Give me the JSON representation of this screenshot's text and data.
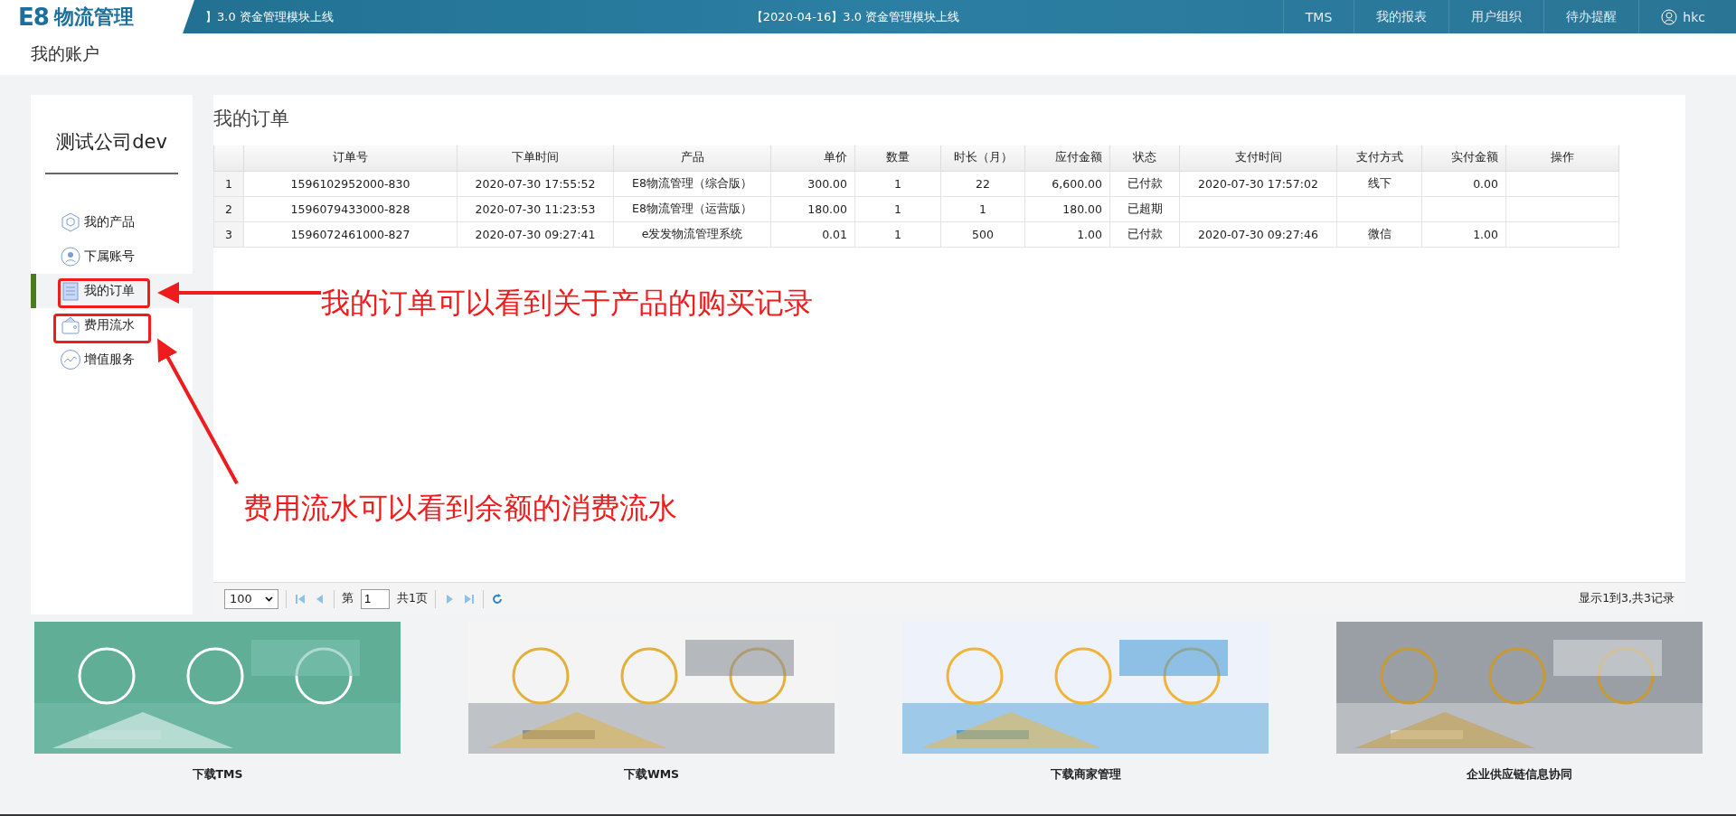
{
  "topbar": {
    "logo_mark": "E8",
    "logo_text": "物流管理",
    "tickers": [
      "】3.0 资金管理模块上线",
      "【2020-04-16】3.0 资金管理模块上线"
    ],
    "nav": [
      "TMS",
      "我的报表",
      "用户组织",
      "待办提醒"
    ],
    "user": "hkc"
  },
  "page_title": "我的账户",
  "sidebar": {
    "company": "测试公司dev",
    "items": [
      {
        "label": "我的产品",
        "selected": false
      },
      {
        "label": "下属账号",
        "selected": false
      },
      {
        "label": "我的订单",
        "selected": true
      },
      {
        "label": "费用流水",
        "selected": false
      },
      {
        "label": "增值服务",
        "selected": false
      }
    ]
  },
  "section_title": "我的订单",
  "table": {
    "columns": [
      "订单号",
      "下单时间",
      "产品",
      "单价",
      "数量",
      "时长（月）",
      "应付金额",
      "状态",
      "支付时间",
      "支付方式",
      "实付金额",
      "操作"
    ],
    "rows": [
      {
        "index": "1",
        "cells": [
          "1596102952000-830",
          "2020-07-30 17:55:52",
          "E8物流管理（综合版）",
          "300.00",
          "1",
          "22",
          "6,600.00",
          "已付款",
          "2020-07-30 17:57:02",
          "线下",
          "0.00",
          ""
        ]
      },
      {
        "index": "2",
        "cells": [
          "1596079433000-828",
          "2020-07-30 11:23:53",
          "E8物流管理（运营版）",
          "180.00",
          "1",
          "1",
          "180.00",
          "已超期",
          "",
          "",
          "",
          ""
        ]
      },
      {
        "index": "3",
        "cells": [
          "1596072461000-827",
          "2020-07-30 09:27:41",
          "e发发物流管理系统",
          "0.01",
          "1",
          "500",
          "1.00",
          "已付款",
          "2020-07-30 09:27:46",
          "微信",
          "1.00",
          ""
        ]
      }
    ]
  },
  "pager": {
    "page_size": "100",
    "page_prefix": "第",
    "page": "1",
    "page_total": "共1页",
    "summary": "显示1到3,共3记录"
  },
  "banners": [
    {
      "caption": "下载TMS",
      "kind": "picture"
    },
    {
      "caption": "下载WMS",
      "kind": "picture"
    },
    {
      "caption": "下载商家管理",
      "kind": "picture"
    },
    {
      "caption": "企业供应链信息协同",
      "kind": "picture"
    }
  ],
  "annotations": [
    "我的订单可以看到关于产品的购买记录",
    "费用流水可以看到余额的消费流水"
  ]
}
